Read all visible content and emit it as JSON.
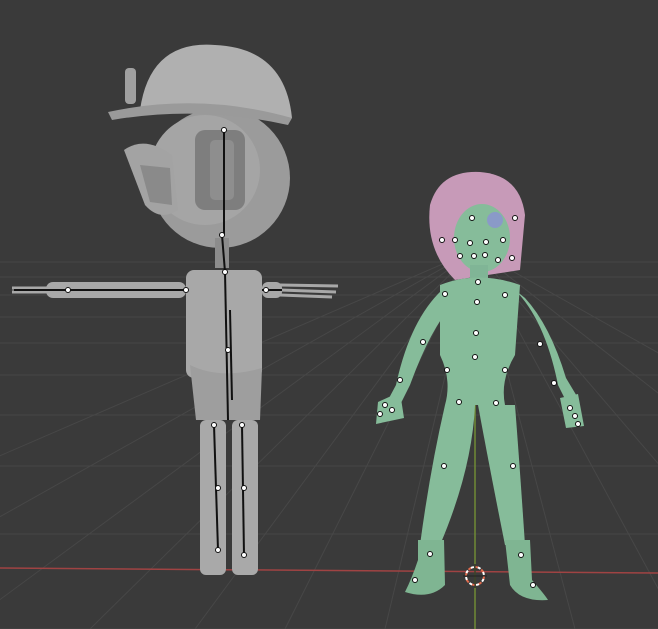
{
  "viewport": {
    "mode": "Object",
    "shading": "solid",
    "show_grid_floor": true,
    "show_x_axis": true,
    "show_y_axis": true,
    "colors": {
      "background": "#3a3a3a",
      "grid": "#474747",
      "x_axis": "#a04343",
      "y_axis": "#6f8a34",
      "robot_mesh": "#a9a9a9",
      "girl_mesh": "#86bc9a",
      "girl_hair": "#c79ab8",
      "armature_bone": "#111111",
      "bone_joint": "#ffffff",
      "cursor": "#e06a4c"
    }
  },
  "objects": [
    {
      "name": "robot-character",
      "type": "mesh",
      "has_armature": true
    },
    {
      "name": "girl-character",
      "type": "mesh",
      "has_armature": true
    }
  ],
  "tools": {
    "cursor_icon": "3d-cursor-icon"
  }
}
